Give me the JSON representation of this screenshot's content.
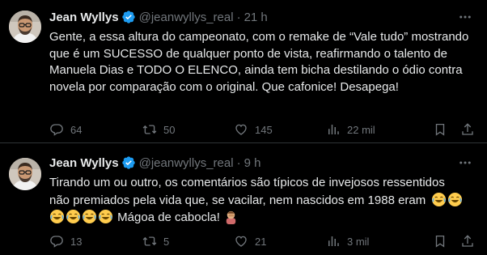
{
  "tweets": [
    {
      "author_name": "Jean Wyllys",
      "handle": "@jeanwyllys_real",
      "dot": "·",
      "time": "21 h",
      "text": "Gente, a essa altura do campeonato, com o remake de “Vale tudo” mostrando que é um SUCESSO de qualquer ponto de vista, reafirmando o talento de Manuela Dias e TODO O ELENCO, ainda tem bicha destilando o ódio contra novela por comparação com o original. Que cafonice! Desapega!",
      "replies": "64",
      "reposts": "50",
      "likes": "145",
      "views": "22 mil"
    },
    {
      "author_name": "Jean Wyllys",
      "handle": "@jeanwyllys_real",
      "dot": "·",
      "time": "9 h",
      "text_line1": "Tirando um ou outro, os comentários são típicos de invejosos ressentidos",
      "text_line2": "não premiados pela vida que, se vacilar, nem nascidos em 1988 eram",
      "text_line3": "Mágoa de cabocla!",
      "emojis": [
        "face-with-tears-of-joy",
        "person-facepalming"
      ],
      "replies": "13",
      "reposts": "5",
      "likes": "21",
      "views": "3 mil"
    }
  ],
  "colors": {
    "background": "#000000",
    "text": "#e7e9ea",
    "muted": "#71767b",
    "verified": "#1d9bf0",
    "divider": "#2f3336"
  }
}
